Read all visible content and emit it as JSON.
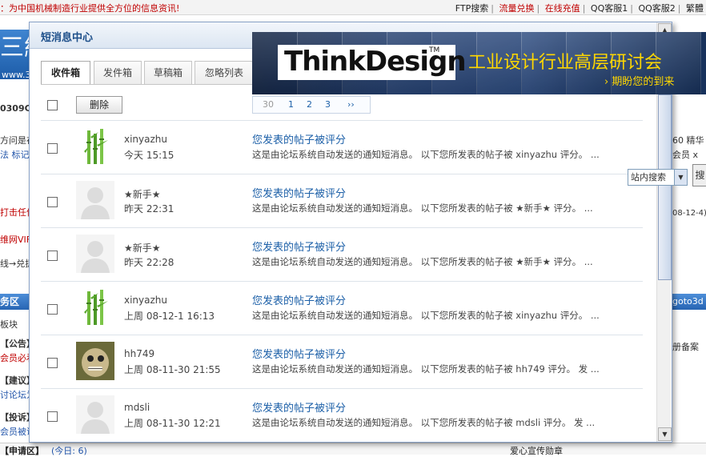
{
  "topbar": {
    "slogan": "：为中国机械制造行业提供全方位的信息资讯!",
    "links": [
      "FTP搜索",
      "流量兑换",
      "在线充值",
      "QQ客服1",
      "QQ客服2",
      "繁體"
    ]
  },
  "background": {
    "left_fragments": [
      "0309C",
      "方问是在",
      "法 标记",
      "打击任何",
      "维网VIF",
      "线→兑提",
      "务区",
      "板块",
      "【公告】",
      "会员必看",
      "【建议】",
      "讨论坛为",
      "【投诉】",
      "会员被诋"
    ],
    "right_fragments": [
      "60 精华",
      "会员 x",
      "08-12-4)",
      "goto3d",
      "册备案"
    ],
    "right_search_label": "搜",
    "bottom": {
      "left": "【申请区】",
      "center": "(今日: 6)",
      "right": "爱心宣传勋章"
    }
  },
  "pm": {
    "title": "短消息中心",
    "tabs": [
      "收件箱",
      "发件箱",
      "草稿箱",
      "忽略列表"
    ],
    "delete_label": "删除",
    "pager": {
      "current": "30",
      "pages": [
        "1",
        "2",
        "3"
      ],
      "next": "››"
    },
    "messages": [
      {
        "user": "xinyazhu",
        "time": "今天  15:15",
        "subject": "您发表的帖子被评分",
        "preview": "这是由论坛系统自动发送的通知短消息。 以下您所发表的帖子被 xinyazhu 评分。 ...",
        "avatar": "bamboo"
      },
      {
        "user": "★新手★",
        "time": "昨天  22:31",
        "subject": "您发表的帖子被评分",
        "preview": "这是由论坛系统自动发送的通知短消息。 以下您所发表的帖子被 ★新手★ 评分。 ...",
        "avatar": "ghost"
      },
      {
        "user": "★新手★",
        "time": "昨天  22:28",
        "subject": "您发表的帖子被评分",
        "preview": "这是由论坛系统自动发送的通知短消息。 以下您所发表的帖子被 ★新手★ 评分。 ...",
        "avatar": "ghost"
      },
      {
        "user": "xinyazhu",
        "time": "上周  08-12-1 16:13",
        "subject": "您发表的帖子被评分",
        "preview": "这是由论坛系统自动发送的通知短消息。 以下您所发表的帖子被 xinyazhu 评分。 ...",
        "avatar": "bamboo"
      },
      {
        "user": "hh749",
        "time": "上周  08-11-30 21:55",
        "subject": "您发表的帖子被评分",
        "preview": "这是由论坛系统自动发送的通知短消息。 以下您所发表的帖子被 hh749 评分。 发 ...",
        "avatar": "photo"
      },
      {
        "user": "mdsli",
        "time": "上周  08-11-30 12:21",
        "subject": "您发表的帖子被评分",
        "preview": "这是由论坛系统自动发送的通知短消息。 以下您所发表的帖子被 mdsli 评分。 发 ...",
        "avatar": "ghost"
      }
    ]
  },
  "banner": {
    "logo": "ThinkDesign",
    "tm": "TM",
    "headline": "工业设计行业高层研讨会",
    "subline": "› 期盼您的到来"
  },
  "site_search": {
    "selected": "站内搜索"
  },
  "colors": {
    "accent": "#1d60a8",
    "title": "#1d4f8a",
    "banner_text": "#ffd700",
    "alert_red": "#c00000"
  }
}
